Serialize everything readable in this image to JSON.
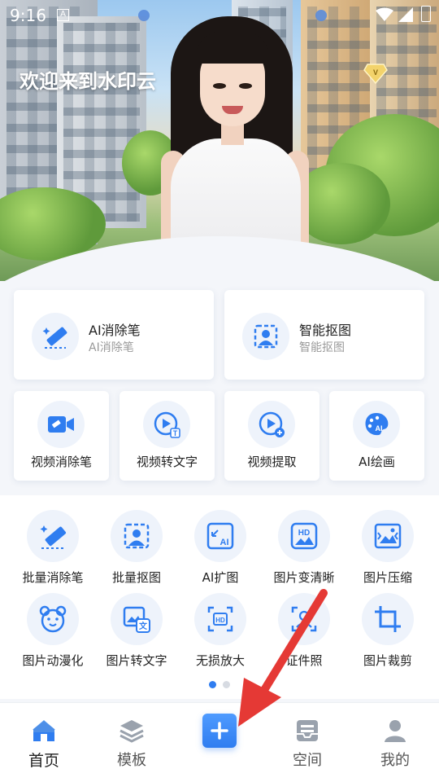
{
  "status_bar": {
    "time": "9:16",
    "notif_glyph": "A"
  },
  "hero": {
    "welcome": "欢迎来到水印云",
    "vip_icon": "diamond-v-icon"
  },
  "features_large": [
    {
      "title": "AI消除笔",
      "subtitle": "AI消除笔",
      "icon": "magic-eraser-icon"
    },
    {
      "title": "智能抠图",
      "subtitle": "智能抠图",
      "icon": "portrait-cutout-icon"
    }
  ],
  "features_medium": [
    {
      "label": "视频消除笔",
      "icon": "video-eraser-icon"
    },
    {
      "label": "视频转文字",
      "icon": "video-to-text-icon"
    },
    {
      "label": "视频提取",
      "icon": "video-extract-icon"
    },
    {
      "label": "AI绘画",
      "icon": "ai-paint-icon"
    }
  ],
  "tools_row1": [
    {
      "label": "批量消除笔",
      "icon": "batch-eraser-icon"
    },
    {
      "label": "批量抠图",
      "icon": "batch-cutout-icon"
    },
    {
      "label": "AI扩图",
      "icon": "ai-expand-icon"
    },
    {
      "label": "图片变清晰",
      "icon": "hd-image-icon"
    },
    {
      "label": "图片压缩",
      "icon": "image-compress-icon"
    }
  ],
  "tools_row2": [
    {
      "label": "图片动漫化",
      "icon": "anime-bear-icon"
    },
    {
      "label": "图片转文字",
      "icon": "image-to-text-icon"
    },
    {
      "label": "无损放大",
      "icon": "hd-upscale-icon"
    },
    {
      "label": "证件照",
      "icon": "id-photo-icon"
    },
    {
      "label": "图片裁剪",
      "icon": "crop-icon"
    }
  ],
  "pager": {
    "pages": 2,
    "active": 1
  },
  "tabbar": {
    "items": [
      {
        "label": "首页",
        "icon": "home-icon",
        "active": true
      },
      {
        "label": "模板",
        "icon": "layers-icon",
        "active": false
      },
      {
        "label": "",
        "icon": "plus-icon",
        "active": false
      },
      {
        "label": "空间",
        "icon": "inbox-icon",
        "active": false
      },
      {
        "label": "我的",
        "icon": "user-icon",
        "active": false
      }
    ]
  },
  "colors": {
    "accent": "#2f7df0",
    "icon_bg": "#eef3fb",
    "annotation_arrow": "#e53935"
  }
}
